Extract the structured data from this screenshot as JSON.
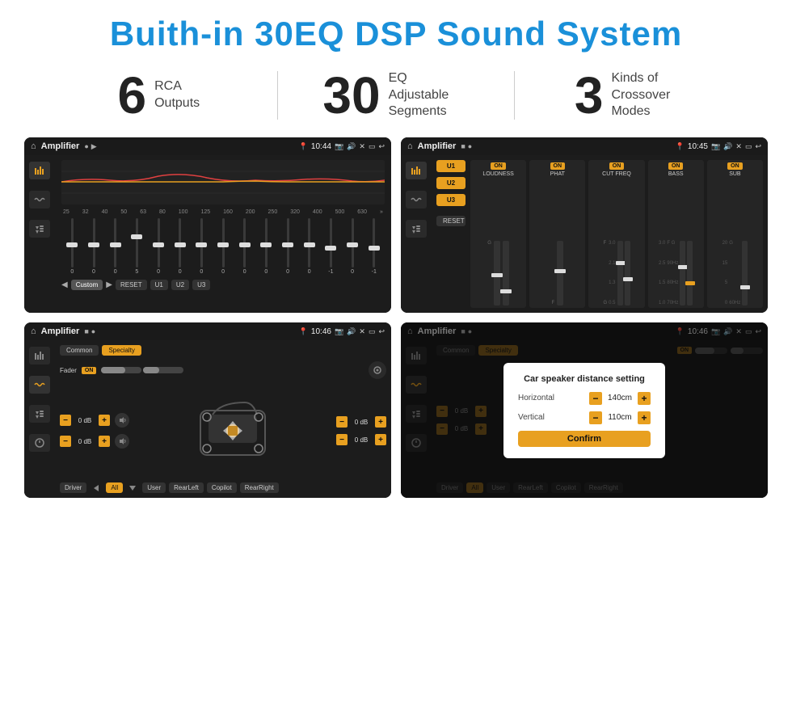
{
  "header": {
    "title": "Buith-in 30EQ DSP Sound System"
  },
  "stats": [
    {
      "number": "6",
      "label": "RCA\nOutputs"
    },
    {
      "number": "30",
      "label": "EQ Adjustable\nSegments"
    },
    {
      "number": "3",
      "label": "Kinds of\nCrossover Modes"
    }
  ],
  "screens": [
    {
      "id": "eq-screen",
      "topbar": {
        "app": "Amplifier",
        "time": "10:44",
        "icons": "📍 📷 🔊 ✕ ▭ ↩"
      },
      "type": "eq",
      "eq_labels": [
        "25",
        "32",
        "40",
        "50",
        "63",
        "80",
        "100",
        "125",
        "160",
        "200",
        "250",
        "320",
        "400",
        "500",
        "630"
      ],
      "eq_values": [
        "0",
        "0",
        "0",
        "5",
        "0",
        "0",
        "0",
        "0",
        "0",
        "0",
        "0",
        "0",
        "-1",
        "0",
        "-1"
      ],
      "preset": "Custom",
      "bottom_buttons": [
        "◀",
        "Custom",
        "▶",
        "RESET",
        "U1",
        "U2",
        "U3"
      ]
    },
    {
      "id": "crossover-screen",
      "topbar": {
        "app": "Amplifier",
        "time": "10:45"
      },
      "type": "crossover",
      "presets": [
        "U1",
        "U2",
        "U3"
      ],
      "channels": [
        {
          "label": "LOUDNESS",
          "on": true
        },
        {
          "label": "PHAT",
          "on": true
        },
        {
          "label": "CUT FREQ",
          "on": true
        },
        {
          "label": "BASS",
          "on": true
        },
        {
          "label": "SUB",
          "on": true
        }
      ],
      "reset_label": "RESET"
    },
    {
      "id": "mixer-screen",
      "topbar": {
        "app": "Amplifier",
        "time": "10:46"
      },
      "type": "mixer",
      "tabs": [
        "Common",
        "Specialty"
      ],
      "fader_label": "Fader",
      "fader_on": "ON",
      "spk_values": [
        "0 dB",
        "0 dB",
        "0 dB",
        "0 dB"
      ],
      "bottom_buttons": [
        "Driver",
        "RearLeft",
        "All",
        "User",
        "Copilot",
        "RearRight"
      ]
    },
    {
      "id": "distance-screen",
      "topbar": {
        "app": "Amplifier",
        "time": "10:46"
      },
      "type": "distance",
      "tabs": [
        "Common",
        "Specialty"
      ],
      "dialog": {
        "title": "Car speaker distance setting",
        "horizontal_label": "Horizontal",
        "horizontal_value": "140cm",
        "vertical_label": "Vertical",
        "vertical_value": "110cm",
        "confirm_label": "Confirm"
      },
      "spk_values": [
        "0 dB",
        "0 dB"
      ],
      "bottom_buttons": [
        "Driver",
        "RearLeft",
        "All",
        "User",
        "Copilot",
        "RearRight"
      ]
    }
  ]
}
